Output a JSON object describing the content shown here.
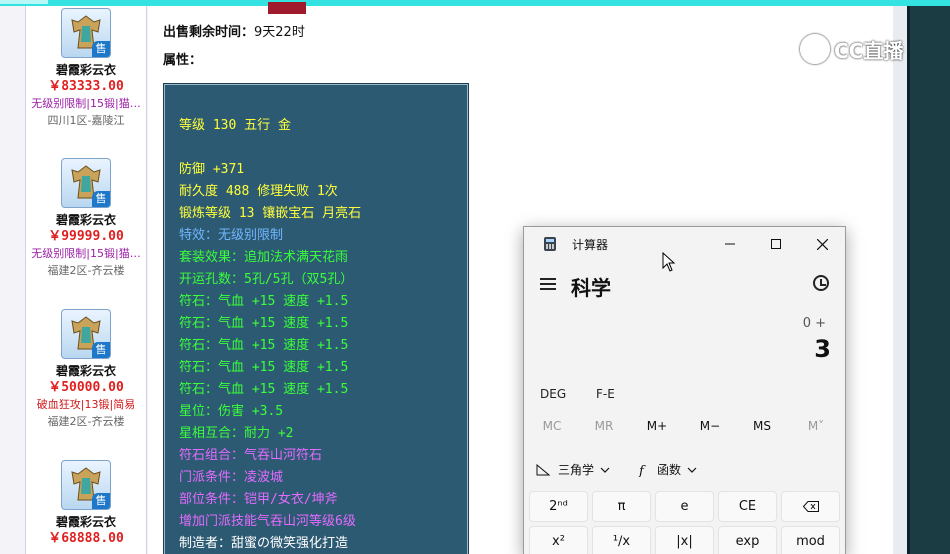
{
  "sidebar": {
    "items": [
      {
        "name": "碧霞彩云衣",
        "price": "￥83333.00",
        "tag": "无级别限制|15锻|猫…",
        "tag_color": "purple",
        "server": "四川1区-嘉陵江",
        "badge": "售"
      },
      {
        "name": "碧霞彩云衣",
        "price": "￥99999.00",
        "tag": "无级别限制|15锻|猫…",
        "tag_color": "purple",
        "server": "福建2区-齐云楼",
        "badge": "售"
      },
      {
        "name": "碧霞彩云衣",
        "price": "￥50000.00",
        "tag": "破血狂攻|13锻|简易",
        "tag_color": "red",
        "server": "福建2区-齐云楼",
        "badge": "售"
      },
      {
        "name": "碧霞彩云衣",
        "price": "￥68888.00",
        "badge": "售"
      }
    ]
  },
  "detail": {
    "time_left_label": "出售剩余时间：",
    "time_left_value": "9天22时",
    "attributes_label": "属性："
  },
  "attributes": [
    {
      "text": "等级 130 五行 金",
      "color": "#ffff3a"
    },
    {
      "text": "",
      "color": "#ffffff"
    },
    {
      "text": "防御 +371",
      "color": "#ffff3a"
    },
    {
      "text": "耐久度 488 修理失败 1次",
      "color": "#ffff3a"
    },
    {
      "text": "锻炼等级 13 镶嵌宝石 月亮石",
      "color": "#ffff3a"
    },
    {
      "text": "特效：无级别限制",
      "color": "#6fb7ff"
    },
    {
      "text": "套装效果：追加法术满天花雨",
      "color": "#3aff3a"
    },
    {
      "text": "开运孔数：5孔/5孔（双5孔）",
      "color": "#3aff3a"
    },
    {
      "text": "符石：气血 +15 速度 +1.5",
      "color": "#3aff3a"
    },
    {
      "text": "符石：气血 +15 速度 +1.5",
      "color": "#3aff3a"
    },
    {
      "text": "符石：气血 +15 速度 +1.5",
      "color": "#3aff3a"
    },
    {
      "text": "符石：气血 +15 速度 +1.5",
      "color": "#3aff3a"
    },
    {
      "text": "符石：气血 +15 速度 +1.5",
      "color": "#3aff3a"
    },
    {
      "text": "星位：伤害 +3.5",
      "color": "#3aff3a"
    },
    {
      "text": "星相互合：耐力 +2",
      "color": "#3aff3a"
    },
    {
      "text": "符石组合：气吞山河符石",
      "color": "#e36bff"
    },
    {
      "text": "门派条件：凌波城",
      "color": "#e36bff"
    },
    {
      "text": "部位条件：铠甲/女衣/坤斧",
      "color": "#e36bff"
    },
    {
      "text": "增加门派技能气吞山河等级6级",
      "color": "#e36bff"
    },
    {
      "text": "制造者：甜蜜の微笑强化打造",
      "color": "#ffffff"
    }
  ],
  "watermark": {
    "text": "CC直播"
  },
  "calculator": {
    "title": "计算器",
    "mode": "科学",
    "expression": "0 +",
    "display": "3",
    "angle_unit": "DEG",
    "fe_label": "F-E",
    "memory": [
      "MC",
      "MR",
      "M+",
      "M−",
      "MS",
      "M˅"
    ],
    "trig_label": "三角学",
    "func_label": "函数",
    "keys_row1": [
      "2ⁿᵈ",
      "π",
      "e",
      "CE",
      "⌫"
    ],
    "keys_row2": [
      "x²",
      "¹∕x",
      "|x|",
      "exp",
      "mod"
    ]
  },
  "icons": [
    "sale-badge-icon",
    "minimize-icon",
    "maximize-icon",
    "close-icon",
    "menu-icon",
    "history-icon",
    "backspace-icon",
    "trig-icon",
    "function-icon",
    "mouse-cursor-icon"
  ]
}
